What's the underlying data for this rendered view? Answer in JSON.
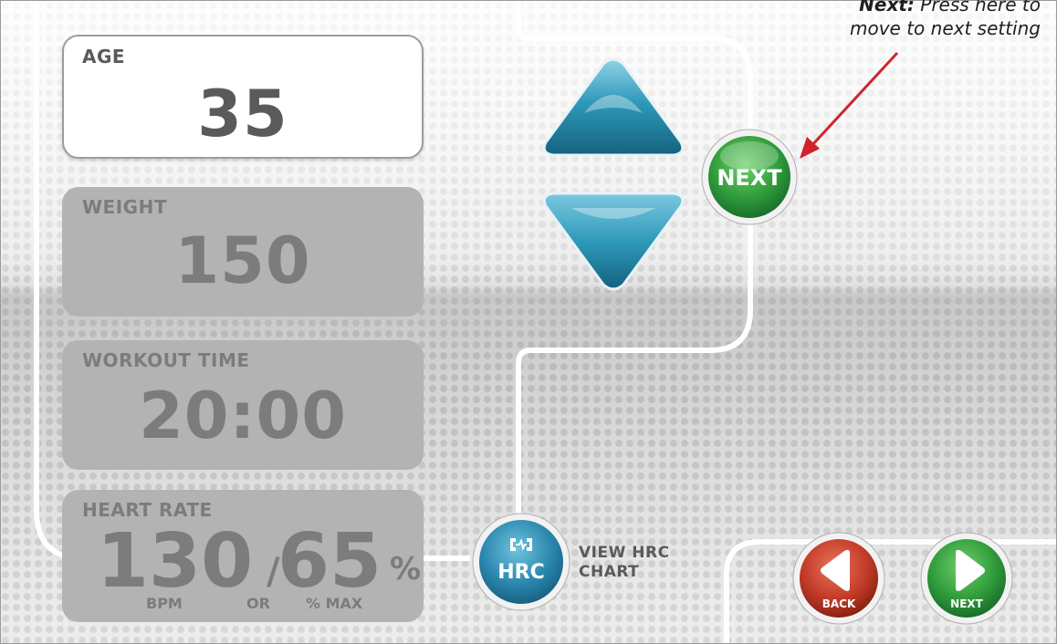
{
  "fields": {
    "age": {
      "label": "AGE",
      "value": "35"
    },
    "weight": {
      "label": "WEIGHT",
      "value": "150"
    },
    "workout_time": {
      "label": "WORKOUT TIME",
      "value": "20:00"
    },
    "heart_rate": {
      "label": "HEART RATE",
      "bpm_value": "130",
      "separator": "/",
      "percent_value": "65",
      "percent_sign": "%",
      "bpm_caption": "BPM",
      "or_caption": "OR",
      "percent_caption": "% MAX"
    }
  },
  "controls": {
    "next_main_label": "NEXT",
    "hrc_label": "HRC",
    "view_hrc_line1": "VIEW HRC",
    "view_hrc_line2": "CHART",
    "back_label": "BACK",
    "next_label": "NEXT"
  },
  "annotation": {
    "title": "Next:",
    "text_line1": "Press here to",
    "text_line2": "move to next setting"
  },
  "colors": {
    "arrow_blue": "#2a8fb0",
    "next_green": "#2f9a3c",
    "back_red": "#c23a26",
    "hrc_blue": "#2a86ad",
    "callout_red": "#d0242a"
  },
  "icons": {
    "up": "triangle-up",
    "down": "triangle-down",
    "back": "play-left",
    "next": "play-right",
    "hrc": "heart-rate-chart"
  }
}
